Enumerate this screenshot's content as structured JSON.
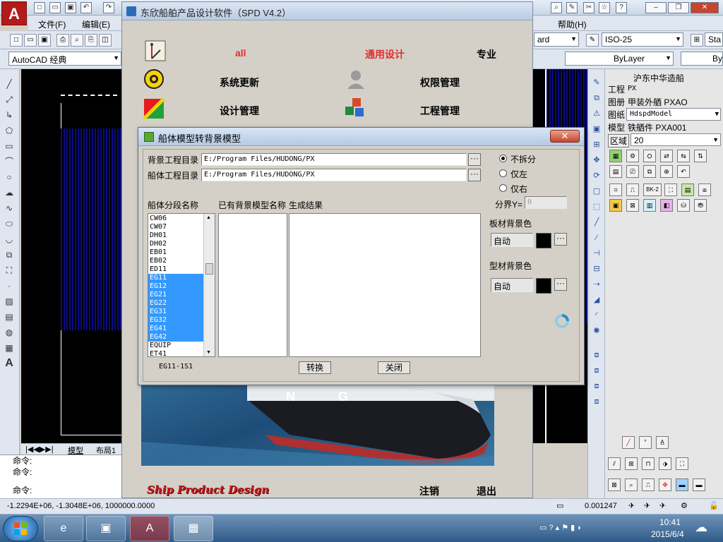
{
  "autocad": {
    "logo": "A",
    "menu": [
      "文件(F)",
      "编辑(E)",
      "帮助(H)"
    ],
    "workspace": "AutoCAD 经典",
    "dimstyle_combo": "ISO-25",
    "textstyle_combo": "ard",
    "style_combo": "Sta",
    "layer_combo": "ByLayer",
    "layer_combo2": "ByL",
    "layout_tabs": [
      "模型",
      "布局1"
    ],
    "command_lines": [
      "命令:",
      "命令:",
      "命令:"
    ],
    "coords": "-1.2294E+06, -1.3048E+06, 1000000.0000",
    "scale_readout": "0.001247"
  },
  "right_panel": {
    "company": "沪东中华造船",
    "project_label": "工程",
    "project_value": "PX",
    "drawing_label": "图册",
    "drawing_value": "甲装外舾 PXAO",
    "paper_label": "图纸",
    "paper_value": "HdspdModel",
    "model_label": "模型",
    "model_value": "铁舾件 PXA001",
    "region_label": "区域",
    "region_value": "20",
    "icon_label_bk2": "BK-2"
  },
  "spd": {
    "title": "东欣船舶产品设计软件（SPD V4.2）",
    "top_all": "all",
    "top_general": "通用设计",
    "top_special": "专业",
    "system_update": "系统更新",
    "permission": "权限管理",
    "design_manage": "设计管理",
    "project_manage": "工程管理",
    "footer_brand": "Ship Product Design",
    "logout": "注销",
    "exit": "退出",
    "ship_text": "N  G"
  },
  "dialog": {
    "title": "船体模型转背景模型",
    "close": "✕",
    "bg_dir_label": "背景工程目录",
    "bg_dir_value": "E:/Program Files/HUDONG/PX",
    "hull_dir_label": "船体工程目录",
    "hull_dir_value": "E:/Program Files/HUDONG/PX",
    "browse": "···",
    "col_segments": "船体分段名称",
    "col_existing": "已有背景模型名称",
    "col_result": "生成结果",
    "segments": [
      {
        "name": "CW06",
        "selected": false
      },
      {
        "name": "CW07",
        "selected": false
      },
      {
        "name": "DH01",
        "selected": false
      },
      {
        "name": "DH02",
        "selected": false
      },
      {
        "name": "EB01",
        "selected": false
      },
      {
        "name": "EB02",
        "selected": false
      },
      {
        "name": "ED11",
        "selected": false
      },
      {
        "name": "EG11",
        "selected": true
      },
      {
        "name": "EG12",
        "selected": true
      },
      {
        "name": "EG21",
        "selected": true
      },
      {
        "name": "EG22",
        "selected": true
      },
      {
        "name": "EG31",
        "selected": true
      },
      {
        "name": "EG32",
        "selected": true
      },
      {
        "name": "EG41",
        "selected": true
      },
      {
        "name": "EG42",
        "selected": true
      },
      {
        "name": "EQUIP",
        "selected": false
      },
      {
        "name": "ET41",
        "selected": false
      }
    ],
    "radio_nosplit": "不拆分",
    "radio_left": "仅左",
    "radio_right": "仅右",
    "split_label": "分界Y=",
    "split_value": "0",
    "plate_bg_label": "板材背景色",
    "plate_bg_value": "自动",
    "profile_bg_label": "型材背景色",
    "profile_bg_value": "自动",
    "status_text": "EG11-1S1",
    "convert": "转换",
    "close_btn": "关闭"
  },
  "taskbar": {
    "time": "10:41",
    "date": "2015/6/4"
  }
}
